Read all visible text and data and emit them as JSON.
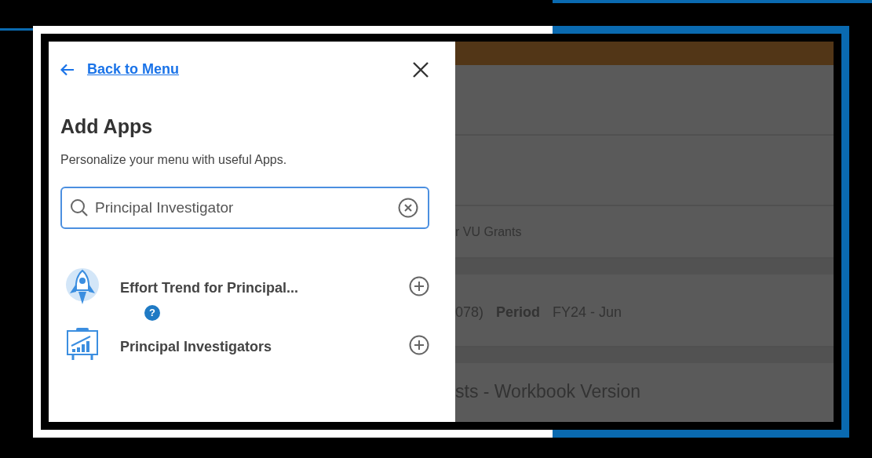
{
  "drawer": {
    "back_link": "Back to Menu",
    "title": "Add Apps",
    "subtitle": "Personalize your menu with useful Apps.",
    "search": {
      "value": "Principal Investigator"
    },
    "apps": [
      {
        "kind": "rocket",
        "name": "Effort Trend for Principal...",
        "help_badge": "?"
      },
      {
        "kind": "chart",
        "name": "Principal Investigators"
      }
    ]
  },
  "background": {
    "rows": [
      {
        "kind": "blank"
      },
      {
        "kind": "blank"
      },
      {
        "kind": "text",
        "text": "r VU Grants"
      },
      {
        "kind": "fields",
        "parts": [
          {
            "text": "078)",
            "kind": "value"
          },
          {
            "text": "Period",
            "kind": "label"
          },
          {
            "text": "FY24 - Jun",
            "kind": "value"
          }
        ]
      },
      {
        "kind": "heading",
        "text": "sts - Workbook Version"
      }
    ]
  }
}
